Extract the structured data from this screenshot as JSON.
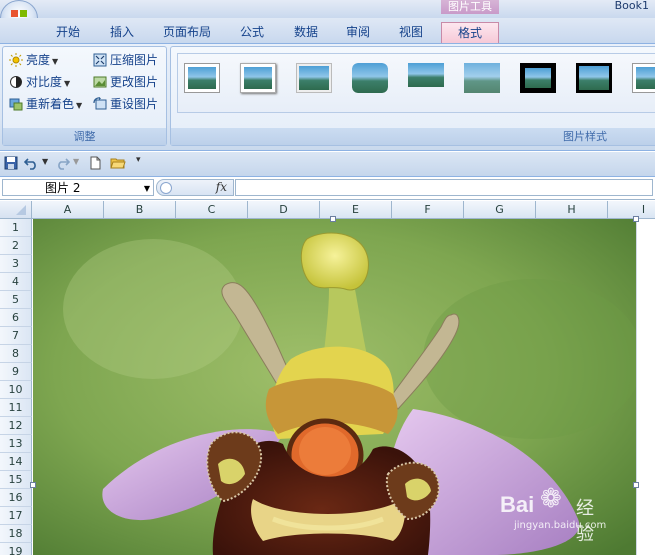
{
  "window": {
    "contextual_tab_group": "图片工具",
    "title": "Book1"
  },
  "tabs": [
    {
      "label": "开始"
    },
    {
      "label": "插入"
    },
    {
      "label": "页面布局"
    },
    {
      "label": "公式"
    },
    {
      "label": "数据"
    },
    {
      "label": "审阅"
    },
    {
      "label": "视图"
    },
    {
      "label": "格式",
      "active": true
    }
  ],
  "ribbon": {
    "adjust_group": {
      "label": "调整",
      "buttons": [
        {
          "label": "亮度",
          "icon": "brightness-icon",
          "dropdown": true
        },
        {
          "label": "对比度",
          "icon": "contrast-icon",
          "dropdown": true
        },
        {
          "label": "重新着色",
          "icon": "recolor-icon",
          "dropdown": true
        },
        {
          "label": "压缩图片",
          "icon": "compress-pictures-icon"
        },
        {
          "label": "更改图片",
          "icon": "change-picture-icon"
        },
        {
          "label": "重设图片",
          "icon": "reset-picture-icon"
        }
      ]
    },
    "styles_group": {
      "label": "图片样式",
      "thumbnail_count": 8
    }
  },
  "quick_access": {
    "icons": [
      "save-icon",
      "undo-icon",
      "redo-icon",
      "new-document-icon",
      "open-folder-icon",
      "customize-qat-icon"
    ]
  },
  "formula_bar": {
    "name_box": "图片 2",
    "fx_label": "fx",
    "formula": ""
  },
  "sheet": {
    "columns": [
      "A",
      "B",
      "C",
      "D",
      "E",
      "F",
      "G",
      "H",
      "I"
    ],
    "rows": [
      "1",
      "2",
      "3",
      "4",
      "5",
      "6",
      "7",
      "8",
      "9",
      "10",
      "11",
      "12",
      "13",
      "14",
      "15",
      "16",
      "17",
      "18",
      "19"
    ]
  },
  "watermark": {
    "brand": "Bai",
    "brand2": "经验",
    "url": "jingyan.baidu.com"
  },
  "colors": {
    "ribbon_bg": "#dbe6f4",
    "active_tab": "#f6c9d7",
    "accent_text": "#15428b",
    "header_border": "#9eb6ce"
  }
}
